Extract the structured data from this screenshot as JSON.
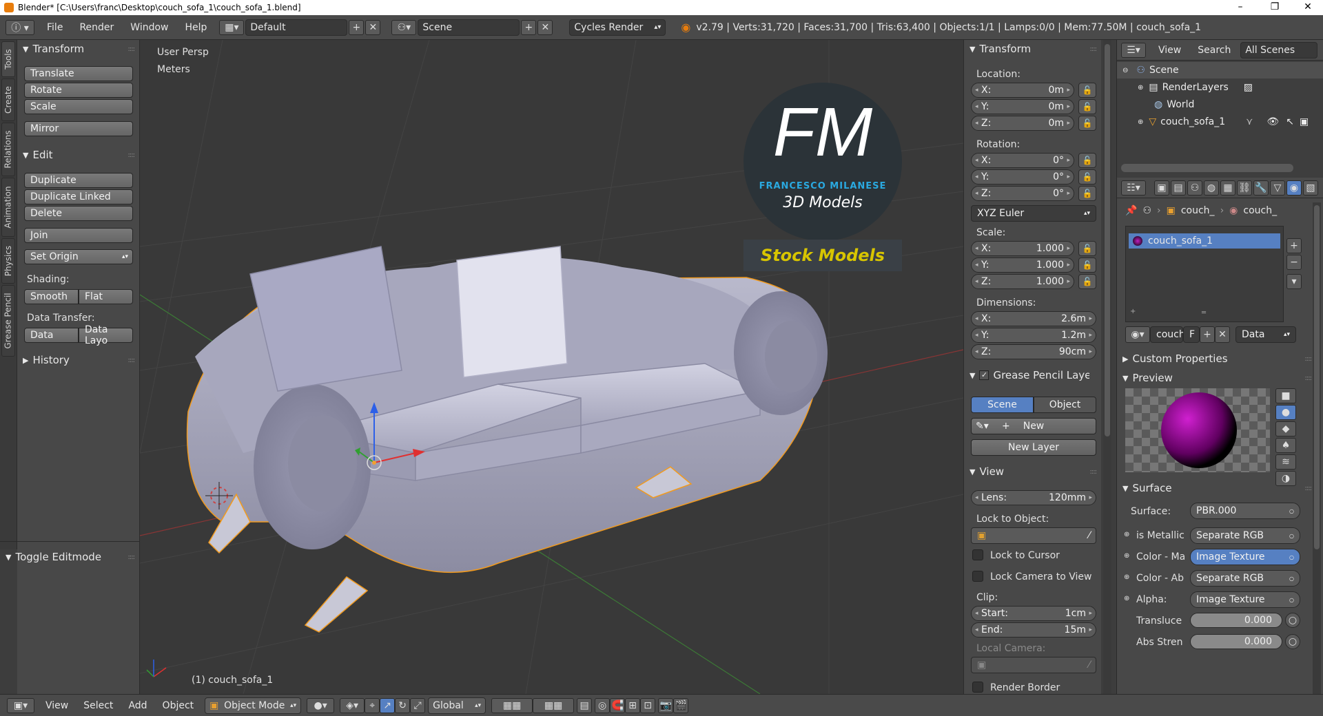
{
  "window": {
    "title": "Blender* [C:\\Users\\franc\\Desktop\\couch_sofa_1\\couch_sofa_1.blend]",
    "minimize": "–",
    "maximize": "❐",
    "close": "✕"
  },
  "info_header": {
    "menus": [
      "File",
      "Render",
      "Window",
      "Help"
    ],
    "layout": "Default",
    "scene": "Scene",
    "engine": "Cycles Render",
    "stats": "v2.79 | Verts:31,720 | Faces:31,700 | Tris:63,400 | Objects:1/1 | Lamps:0/0 | Mem:77.50M | couch_sofa_1"
  },
  "left_tabs": [
    "Tools",
    "Create",
    "Relations",
    "Animation",
    "Physics",
    "Grease Pencil"
  ],
  "tool_shelf": {
    "transform_title": "Transform",
    "translate": "Translate",
    "rotate": "Rotate",
    "scale": "Scale",
    "mirror": "Mirror",
    "edit_title": "Edit",
    "duplicate": "Duplicate",
    "duplicate_linked": "Duplicate Linked",
    "delete": "Delete",
    "join": "Join",
    "set_origin": "Set Origin",
    "shading_label": "Shading:",
    "smooth": "Smooth",
    "flat": "Flat",
    "data_transfer_label": "Data Transfer:",
    "data": "Data",
    "data_layout": "Data Layo",
    "history": "History",
    "toggle_editmode": "Toggle Editmode"
  },
  "viewport": {
    "view_name": "User Persp",
    "units": "Meters",
    "object_label": "(1) couch_sofa_1",
    "logo_fm": "FM",
    "logo_name": "FRANCESCO MILANESE",
    "logo_sub": "3D Models",
    "logo_stock": "Stock Models"
  },
  "n_panel": {
    "transform_title": "Transform",
    "location_label": "Location:",
    "loc": [
      {
        "k": "X:",
        "v": "0m"
      },
      {
        "k": "Y:",
        "v": "0m"
      },
      {
        "k": "Z:",
        "v": "0m"
      }
    ],
    "rotation_label": "Rotation:",
    "rot": [
      {
        "k": "X:",
        "v": "0°"
      },
      {
        "k": "Y:",
        "v": "0°"
      },
      {
        "k": "Z:",
        "v": "0°"
      }
    ],
    "rotation_mode": "XYZ Euler",
    "scale_label": "Scale:",
    "scl": [
      {
        "k": "X:",
        "v": "1.000"
      },
      {
        "k": "Y:",
        "v": "1.000"
      },
      {
        "k": "Z:",
        "v": "1.000"
      }
    ],
    "dimensions_label": "Dimensions:",
    "dim": [
      {
        "k": "X:",
        "v": "2.6m"
      },
      {
        "k": "Y:",
        "v": "1.2m"
      },
      {
        "k": "Z:",
        "v": "90cm"
      }
    ],
    "grease_title": "Grease Pencil Layer",
    "gp_scene": "Scene",
    "gp_object": "Object",
    "gp_new": "New",
    "gp_new_layer": "New Layer",
    "view_title": "View",
    "lens": {
      "k": "Lens:",
      "v": "120mm"
    },
    "lock_object_label": "Lock to Object:",
    "lock_cursor": "Lock to Cursor",
    "lock_camera": "Lock Camera to View",
    "clip_label": "Clip:",
    "clip_start": {
      "k": "Start:",
      "v": "1cm"
    },
    "clip_end": {
      "k": "End:",
      "v": "15m"
    },
    "local_camera_label": "Local Camera:",
    "render_border": "Render Border"
  },
  "outliner": {
    "view": "View",
    "search": "Search",
    "filter": "All Scenes",
    "items": [
      "Scene",
      "RenderLayers",
      "World",
      "couch_sofa_1"
    ]
  },
  "properties": {
    "breadcrumb": [
      "couch_",
      "couch_"
    ],
    "material_slot": "couch_sofa_1",
    "mat_name": "couch",
    "mat_f": "F",
    "mat_link": "Data",
    "custom_props": "Custom Properties",
    "preview": "Preview",
    "surface_title": "Surface",
    "surface_label": "Surface:",
    "surface_value": "PBR.000",
    "inputs": [
      {
        "k": "is Metallic",
        "v": "Separate RGB"
      },
      {
        "k": "Color - Ma",
        "v": "Image Texture"
      },
      {
        "k": "Color - Ab",
        "v": "Separate RGB"
      },
      {
        "k": "Alpha:",
        "v": "Image Texture"
      }
    ],
    "translucent": {
      "k": "Transluce",
      "v": "0.000"
    },
    "abs_strength": {
      "k": "Abs Stren",
      "v": "0.000"
    }
  },
  "bottom_bar": {
    "menus": [
      "View",
      "Select",
      "Add",
      "Object"
    ],
    "mode": "Object Mode",
    "orientation": "Global"
  },
  "colors": {
    "selection_outline": "#f29a1d",
    "active_blue": "#5680c2",
    "x_axis": "#e03030",
    "y_axis": "#30a030",
    "z_axis": "#2c5fe8"
  }
}
